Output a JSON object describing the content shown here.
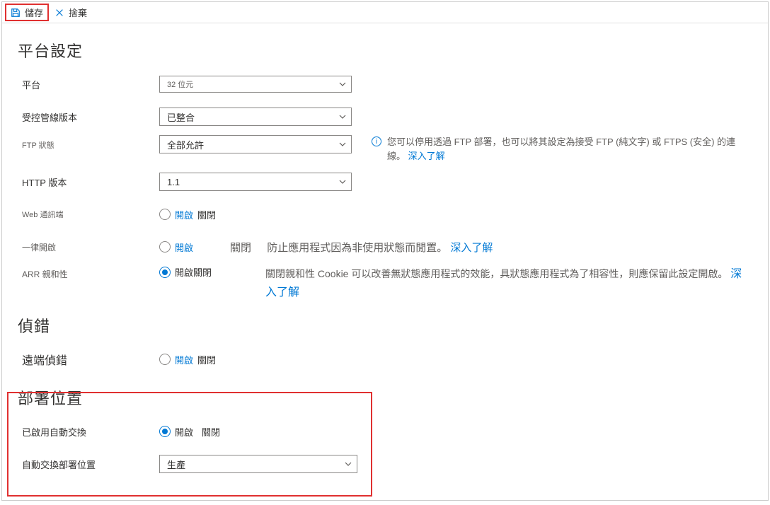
{
  "toolbar": {
    "save_label": "儲存",
    "discard_label": "捨棄"
  },
  "sections": {
    "platform": "平台設定",
    "debug": "偵錯",
    "slots": "部署位置"
  },
  "platform": {
    "label": "平台",
    "value": "32 位元"
  },
  "pipeline": {
    "label": "受控管線版本",
    "value": "已整合"
  },
  "ftp": {
    "label": "FTP 狀態",
    "value": "全部允許",
    "hint_pre": "您可以停用透過 FTP 部署，也可以將其設定為接受 FTP (純文字) 或 FTPS (安全) 的連線。",
    "learn_more": "深入了解"
  },
  "http": {
    "label": "HTTP 版本",
    "value": "1.1"
  },
  "websockets": {
    "label": "Web 通訊端",
    "on": "開啟",
    "off": "關閉"
  },
  "always_on": {
    "label": "一律開啟",
    "on": "開啟",
    "off": "關閉",
    "hint_text": "防止應用程式因為非使用狀態而閒置。",
    "learn_more": "深入了解"
  },
  "arr": {
    "label": "ARR 親和性",
    "on": "開啟",
    "off": "關閉",
    "hint_line1": "關閉親和性 Cookie 可以改善無狀態應用程式的效能，具狀態應用程式為了相容性，則應保留此設定開啟。",
    "learn_more": "深入了解"
  },
  "remote_debug": {
    "label": "遠端偵錯",
    "on": "開啟",
    "off": "關閉"
  },
  "auto_swap_enabled": {
    "label": "已啟用自動交換",
    "on": "開啟",
    "off": "關閉"
  },
  "auto_swap_slot": {
    "label": "自動交換部署位置",
    "value": "生產"
  }
}
